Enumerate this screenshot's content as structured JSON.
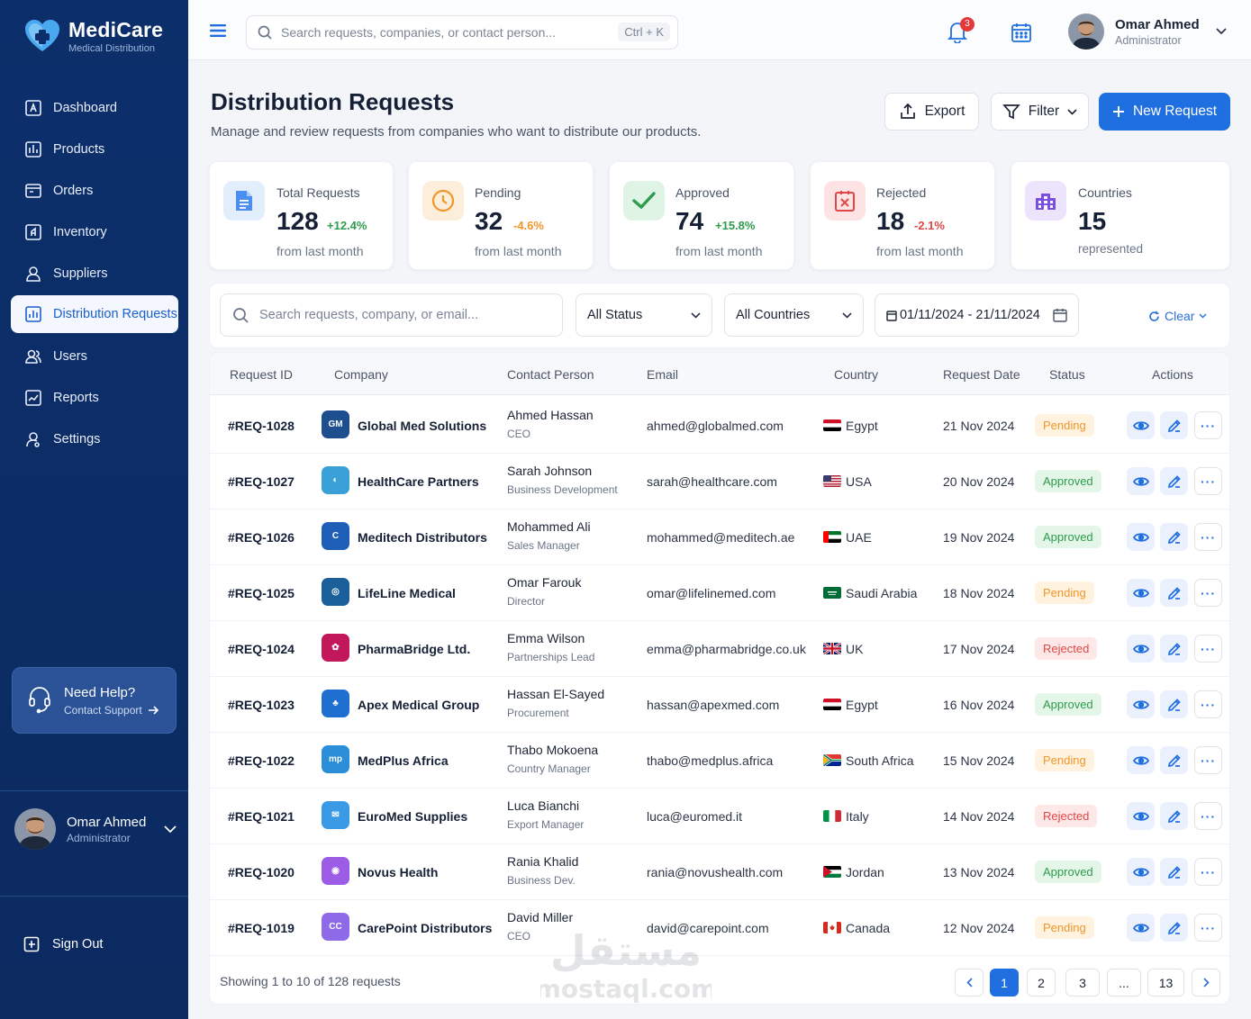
{
  "app": {
    "name": "MediCare",
    "tagline": "Medical Distribution"
  },
  "sidebar": {
    "items": [
      {
        "label": "Dashboard",
        "icon": "dashboard-icon"
      },
      {
        "label": "Products",
        "icon": "products-icon"
      },
      {
        "label": "Orders",
        "icon": "orders-icon"
      },
      {
        "label": "Inventory",
        "icon": "inventory-icon"
      },
      {
        "label": "Suppliers",
        "icon": "suppliers-icon"
      },
      {
        "label": "Distribution Requests",
        "icon": "distribution-icon",
        "active": true
      },
      {
        "label": "Users",
        "icon": "users-icon"
      },
      {
        "label": "Reports",
        "icon": "reports-icon"
      },
      {
        "label": "Settings",
        "icon": "settings-icon"
      }
    ],
    "help": {
      "title": "Need Help?",
      "link": "Contact Support"
    },
    "user": {
      "name": "Omar Ahmed",
      "role": "Administrator"
    },
    "signout": "Sign Out"
  },
  "topbar": {
    "search_placeholder": "Search requests, companies, or contact person...",
    "shortcut": "Ctrl + K",
    "notifications": "3",
    "user": {
      "name": "Omar Ahmed",
      "role": "Administrator"
    }
  },
  "header": {
    "title": "Distribution Requests",
    "subtitle": "Manage and review requests from companies who want to distribute our products.",
    "export_label": "Export",
    "filter_label": "Filter",
    "new_label": "New Request"
  },
  "stats": [
    {
      "label": "Total Requests",
      "value": "128",
      "delta": "+12.4%",
      "foot": "from last month",
      "color": "#2a6fd8"
    },
    {
      "label": "Pending",
      "value": "32",
      "delta": "-4.6%",
      "foot": "from last month",
      "color": "#f0962a"
    },
    {
      "label": "Approved",
      "value": "74",
      "delta": "+15.8%",
      "foot": "from last month",
      "color": "#2e9b4d"
    },
    {
      "label": "Rejected",
      "value": "18",
      "delta": "-2.1%",
      "foot": "from last month",
      "color": "#e04848"
    },
    {
      "label": "Countries",
      "value": "15",
      "delta": "",
      "foot": "represented",
      "color": "#7a4fe0"
    }
  ],
  "filters": {
    "search_placeholder": "Search requests, company, or email...",
    "status": "All Status",
    "country": "All Countries",
    "date_range": "01/11/2024 - 21/11/2024",
    "clear": "Clear"
  },
  "table": {
    "columns": [
      "Request ID",
      "Company",
      "Contact Person",
      "Email",
      "Country",
      "Request Date",
      "Status",
      "Actions"
    ],
    "rows": [
      {
        "id": "#REQ-1028",
        "company": "Global Med Solutions",
        "contact": "Ahmed Hassan",
        "role": "CEO",
        "email": "ahmed@globalmed.com",
        "country": "Egypt",
        "date": "21 Nov 2024",
        "status": "Pending"
      },
      {
        "id": "#REQ-1027",
        "company": "HealthCare Partners",
        "contact": "Sarah Johnson",
        "role": "Business Development",
        "email": "sarah@healthcare.com",
        "country": "USA",
        "date": "20 Nov 2024",
        "status": "Approved"
      },
      {
        "id": "#REQ-1026",
        "company": "Meditech Distributors",
        "contact": "Mohammed Ali",
        "role": "Sales Manager",
        "email": "mohammed@meditech.ae",
        "country": "UAE",
        "date": "19 Nov 2024",
        "status": "Approved"
      },
      {
        "id": "#REQ-1025",
        "company": "LifeLine Medical",
        "contact": "Omar Farouk",
        "role": "Director",
        "email": "omar@lifelinemed.com",
        "country": "Saudi Arabia",
        "date": "18 Nov 2024",
        "status": "Pending"
      },
      {
        "id": "#REQ-1024",
        "company": "PharmaBridge Ltd.",
        "contact": "Emma Wilson",
        "role": "Partnerships Lead",
        "email": "emma@pharmabridge.co.uk",
        "country": "UK",
        "date": "17 Nov 2024",
        "status": "Rejected"
      },
      {
        "id": "#REQ-1023",
        "company": "Apex Medical Group",
        "contact": "Hassan El-Sayed",
        "role": "Procurement",
        "email": "hassan@apexmed.com",
        "country": "Egypt",
        "date": "16 Nov 2024",
        "status": "Approved"
      },
      {
        "id": "#REQ-1022",
        "company": "MedPlus Africa",
        "contact": "Thabo Mokoena",
        "role": "Country Manager",
        "email": "thabo@medplus.africa",
        "country": "South Africa",
        "date": "15 Nov 2024",
        "status": "Pending"
      },
      {
        "id": "#REQ-1021",
        "company": "EuroMed Supplies",
        "contact": "Luca Bianchi",
        "role": "Export Manager",
        "email": "luca@euromed.it",
        "country": "Italy",
        "date": "14 Nov 2024",
        "status": "Rejected"
      },
      {
        "id": "#REQ-1020",
        "company": "Novus Health",
        "contact": "Rania Khalid",
        "role": "Business Dev.",
        "email": "rania@novushealth.com",
        "country": "Jordan",
        "date": "13 Nov 2024",
        "status": "Approved"
      },
      {
        "id": "#REQ-1019",
        "company": "CarePoint Distributors",
        "contact": "David Miller",
        "role": "CEO",
        "email": "david@carepoint.com",
        "country": "Canada",
        "date": "12 Nov 2024",
        "status": "Pending"
      }
    ],
    "footer": "Showing 1 to 10 of 128 requests",
    "pages": [
      "1",
      "2",
      "3",
      "...",
      "13"
    ]
  },
  "watermark": {
    "arabic": "مستقل",
    "latin": "mostaql.com"
  }
}
